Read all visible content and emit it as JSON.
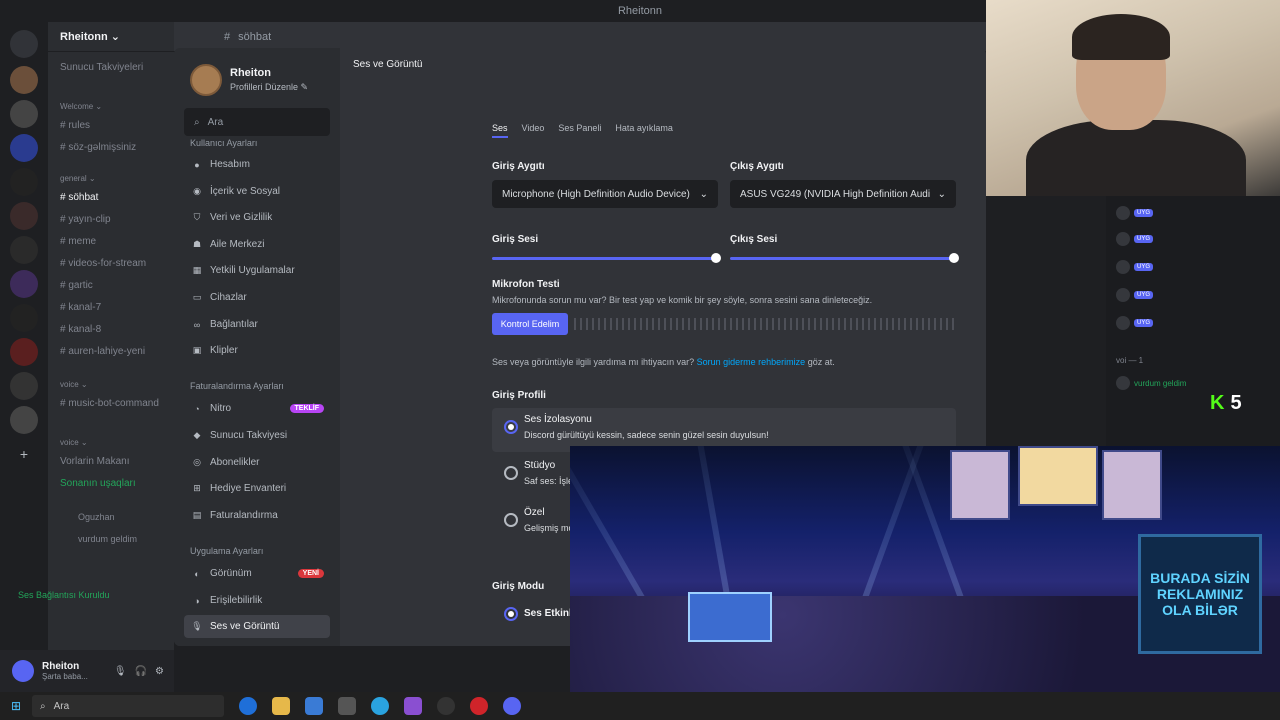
{
  "window": {
    "title": "Rheitonn"
  },
  "server": {
    "name": "Rheitonn ⌄",
    "header_channel": "söhbat"
  },
  "channels": [
    {
      "label": "Sunucu Takviyeleri",
      "top": 0
    },
    {
      "label": "Welcome ⌄",
      "top": 0
    },
    {
      "label": "# rules",
      "top": 0
    },
    {
      "label": "# söz-gəlmişsiniz",
      "top": 0
    },
    {
      "label": "general ⌄",
      "top": 0
    },
    {
      "label": "# söhbat",
      "top": 0
    },
    {
      "label": "# yayın-clip",
      "top": 0
    },
    {
      "label": "# meme",
      "top": 0
    },
    {
      "label": "# videos-for-stream",
      "top": 0
    },
    {
      "label": "# gartic",
      "top": 0
    },
    {
      "label": "# kanal-7",
      "top": 0
    },
    {
      "label": "# kanal-8",
      "top": 0
    },
    {
      "label": "# auren-lahiye-yeni",
      "top": 0
    },
    {
      "label": "voice ⌄",
      "top": 0
    },
    {
      "label": "# music-bot-command",
      "top": 0
    },
    {
      "label": "voice ⌄",
      "top": 0
    },
    {
      "label": "Vorlarin Makanı",
      "top": 0
    },
    {
      "label": "Sonanın uşaqları",
      "top": 0
    },
    {
      "label": "Oguzhan",
      "top": 0
    },
    {
      "label": "vurdum geldim",
      "top": 0
    },
    {
      "label": "Ses Bağlantısı Kuruldu",
      "top": 0
    }
  ],
  "user_panel": {
    "name": "Rheiton",
    "status": "Şarta baba..."
  },
  "settings": {
    "profile_name": "Rheiton",
    "profile_edit": "Profilleri Düzenle ✎",
    "search_placeholder": "Ara",
    "section_user": "Kullanıcı Ayarları",
    "user_items": [
      "Hesabım",
      "İçerik ve Sosyal",
      "Veri ve Gizlilik",
      "Aile Merkezi",
      "Yetkili Uygulamalar",
      "Cihazlar",
      "Bağlantılar",
      "Klipler"
    ],
    "section_billing": "Faturalandırma Ayarları",
    "billing_items": [
      "Nitro",
      "Sunucu Takviyesi",
      "Abonelikler",
      "Hediye Envanteri",
      "Faturalandırma"
    ],
    "nitro_badge": "TEKLİF",
    "section_app": "Uygulama Ayarları",
    "app_items": [
      "Görünüm",
      "Erişilebilirlik",
      "Ses ve Görüntü"
    ],
    "appearance_badge": "YENİ",
    "page_title": "Ses ve Görüntü",
    "tabs": [
      "Ses",
      "Video",
      "Ses Paneli",
      "Hata ayıklama"
    ],
    "input_device_label": "Giriş Aygıtı",
    "input_device_value": "Microphone (High Definition Audio Device)",
    "output_device_label": "Çıkış Aygıtı",
    "output_device_value": "ASUS VG249 (NVIDIA High Definition Audio)",
    "input_volume_label": "Giriş Sesi",
    "output_volume_label": "Çıkış Sesi",
    "input_volume": 1.0,
    "output_volume": 1.0,
    "mic_test_label": "Mikrofon Testi",
    "mic_test_desc": "Mikrofonunda sorun mu var? Bir test yap ve komik bir şey söyle, sonra sesini sana dinleteceğiz.",
    "mic_test_button": "Kontrol Edelim",
    "help_prefix": "Ses veya görüntüyle ilgili yardıma mı ihtiyacın var?",
    "help_link": "Sorun giderme rehberimize",
    "help_suffix": "göz at.",
    "input_profile_label": "Giriş Profili",
    "profiles": [
      {
        "title": "Ses İzolasyonu",
        "desc": "Discord gürültüyü kessin, sadece senin güzel sesin duyulsun!"
      },
      {
        "title": "Stüdyo",
        "desc": "Saf ses: İşle"
      },
      {
        "title": "Özel",
        "desc": "Gelişmiş mo"
      }
    ],
    "input_mode_label": "Giriş Modu",
    "input_mode_value": "Ses Etkinl"
  },
  "chat": {
    "users": [
      "UYG",
      "UYG",
      "UYG",
      "UYG",
      "UYG"
    ],
    "voice_label": "voi — 1",
    "voice_user": "vurdum geldim",
    "kick_count": "5"
  },
  "ad": {
    "text": "BURADA SİZİN REKLAMINIZ OLA BİLƏR"
  },
  "taskbar": {
    "search": "Ara"
  },
  "colors": {
    "accent": "#5865f2",
    "nitro": "#b845f5",
    "new_badge": "#da373c",
    "kick": "#53fc18"
  }
}
